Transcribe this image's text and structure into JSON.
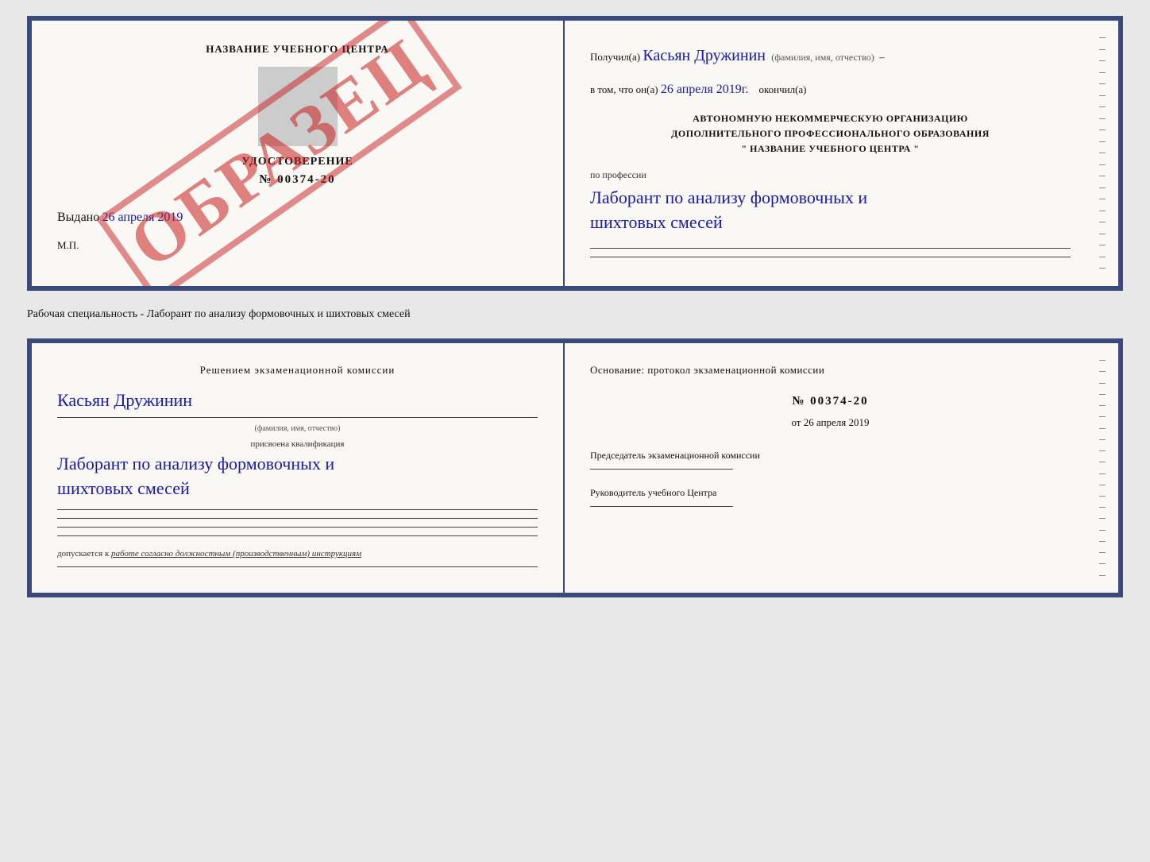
{
  "top_cert": {
    "left": {
      "title": "НАЗВАНИЕ УЧЕБНОГО ЦЕНТРА",
      "cert_label": "УДОСТОВЕРЕНИЕ",
      "cert_number": "№ 00374-20",
      "issued_label": "Выдано",
      "issued_date_handwritten": "26 апреля 2019",
      "mp_label": "М.П.",
      "watermark": "ОБРАЗЕЦ"
    },
    "right": {
      "received_label": "Получил(а)",
      "received_name_handwritten": "Касьян Дружинин",
      "fio_hint": "(фамилия, имя, отчество)",
      "in_that_label": "в том, что он(а)",
      "date_handwritten": "26 апреля 2019г.",
      "finished_label": "окончил(а)",
      "org_line1": "АВТОНОМНУЮ НЕКОММЕРЧЕСКУЮ ОРГАНИЗАЦИЮ",
      "org_line2": "ДОПОЛНИТЕЛЬНОГО ПРОФЕССИОНАЛЬНОГО ОБРАЗОВАНИЯ",
      "org_line3": "\"   НАЗВАНИЕ УЧЕБНОГО ЦЕНТРА   \"",
      "profession_label": "по профессии",
      "profession_handwritten_1": "Лаборант по анализу формовочных и",
      "profession_handwritten_2": "шихтовых смесей"
    }
  },
  "specialty_line": "Рабочая специальность - Лаборант по анализу формовочных и шихтовых смесей",
  "bottom_cert": {
    "left": {
      "commission_header": "Решением экзаменационной комиссии",
      "name_handwritten": "Касьян Дружинин",
      "fio_hint": "(фамилия, имя, отчество)",
      "qual_label": "присвоена квалификация",
      "qual_handwritten_1": "Лаборант по анализу формовочных и",
      "qual_handwritten_2": "шихтовых смесей",
      "allows_label": "допускается к",
      "allows_text": "работе согласно должностным (производственным) инструкциям"
    },
    "right": {
      "basis_label": "Основание: протокол экзаменационной комиссии",
      "protocol_number": "№ 00374-20",
      "date_prefix": "от",
      "date": "26 апреля 2019",
      "chairman_label": "Председатель экзаменационной комиссии",
      "head_label": "Руководитель учебного Центра"
    }
  }
}
